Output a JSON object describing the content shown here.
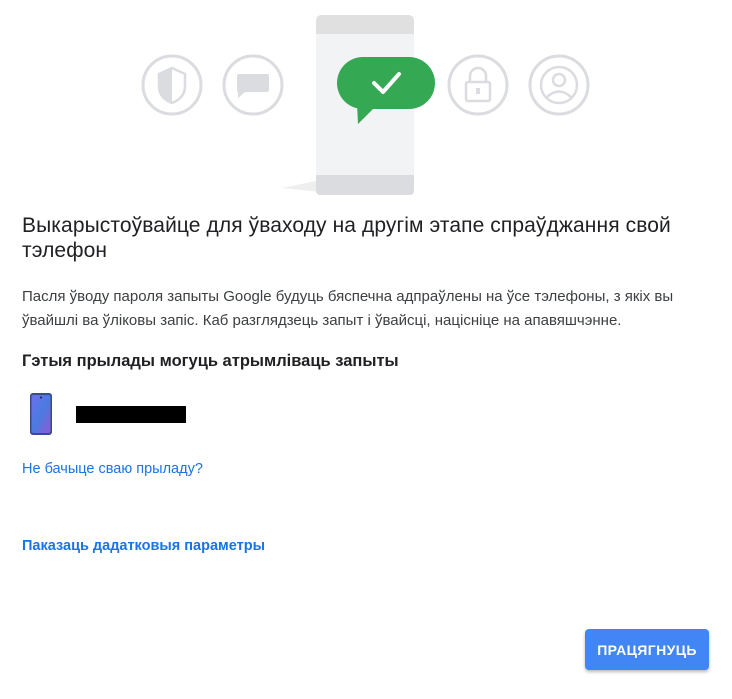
{
  "hero": {
    "icons": [
      "shield-icon",
      "chat-bubble-icon",
      "checkmark-icon",
      "lock-icon",
      "account-icon"
    ],
    "accent_green": "#34a853"
  },
  "title": "Выкарыстоўвайце для ўваходу на другім этапе спраўджання свой тэлефон",
  "description": "Пасля ўводу пароля запыты Google будуць бяспечна адпраўлены на ўсе тэлефоны, з якіх вы ўвайшлі ва ўліковы запіс. Каб разглядзець запыт і ўвайсці, націсніце на апавяшчэнне.",
  "devices_heading": "Гэтыя прылады могуць атрымліваць запыты",
  "devices": [
    {
      "icon": "smartphone-icon"
    }
  ],
  "links": {
    "device_missing": "Не бачыце сваю прыладу?",
    "more_options": "Паказаць дадатковыя параметры"
  },
  "buttons": {
    "continue": "ПРАЦЯГНУЦЬ"
  },
  "colors": {
    "link": "#1a73e8",
    "primary_button": "#4285f4",
    "green": "#34a853"
  }
}
